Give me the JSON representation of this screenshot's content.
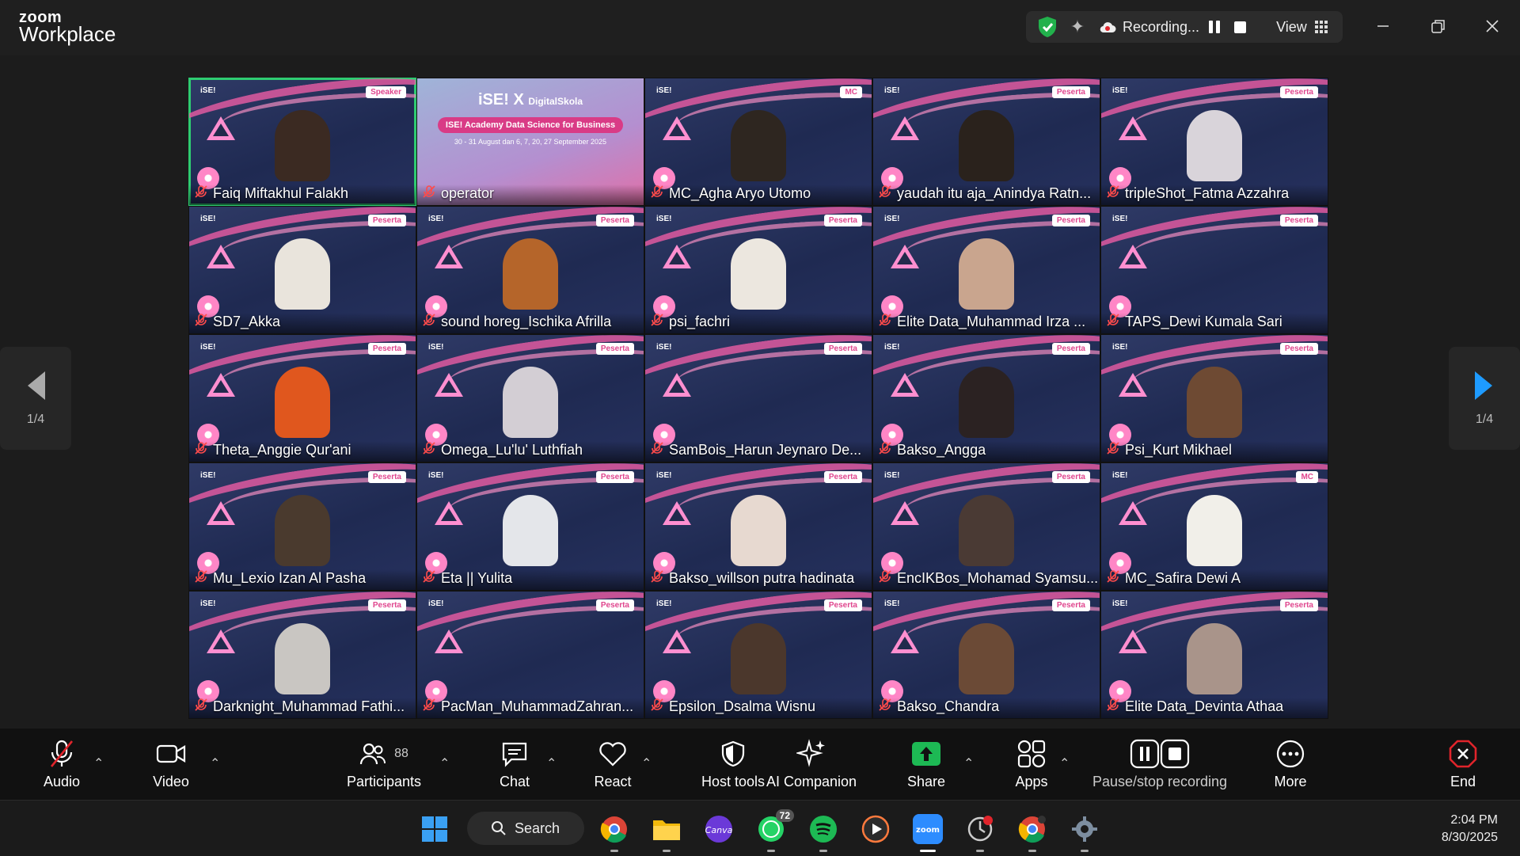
{
  "app": {
    "logo_top": "zoom",
    "logo_bottom": "Workplace"
  },
  "recording": {
    "status": "Recording...",
    "view_label": "View"
  },
  "navigation": {
    "page_left": "1/4",
    "page_right": "1/4"
  },
  "operator_tile": {
    "brand_left": "iSE!",
    "brand_x": "X",
    "brand_right": "DigitalSkola",
    "course": "ISE! Academy Data Science for Business",
    "dates": "30 - 31 August dan 6, 7, 20, 27 September 2025"
  },
  "participants": [
    {
      "name": "Faiq Miftakhul Falakh",
      "tag": "Speaker",
      "avatar_color": "#3b2a22"
    },
    {
      "name": "operator",
      "tag": "",
      "avatar_color": ""
    },
    {
      "name": "MC_Agha Aryo Utomo",
      "tag": "MC",
      "avatar_color": "#2e2620"
    },
    {
      "name": "yaudah itu aja_Anindya Ratn...",
      "tag": "Peserta",
      "avatar_color": "#2a221c"
    },
    {
      "name": "tripleShot_Fatma Azzahra",
      "tag": "Peserta",
      "avatar_color": "#d9d4da"
    },
    {
      "name": "SD7_Akka",
      "tag": "Peserta",
      "avatar_color": "#e9e4dc"
    },
    {
      "name": "sound horeg_Ischika Afrilla",
      "tag": "Peserta",
      "avatar_color": "#b5652a"
    },
    {
      "name": "psi_fachri",
      "tag": "Peserta",
      "avatar_color": "#ece7df"
    },
    {
      "name": "Elite Data_Muhammad Irza ...",
      "tag": "Peserta",
      "avatar_color": "#c9a58e"
    },
    {
      "name": "TAPS_Dewi Kumala Sari",
      "tag": "Peserta",
      "avatar_color": ""
    },
    {
      "name": "Theta_Anggie Qur'ani",
      "tag": "Peserta",
      "avatar_color": "#e0571e"
    },
    {
      "name": "Omega_Lu'lu' Luthfiah",
      "tag": "Peserta",
      "avatar_color": "#d3ced4"
    },
    {
      "name": "SamBois_Harun Jeynaro De...",
      "tag": "Peserta",
      "avatar_color": ""
    },
    {
      "name": "Bakso_Angga",
      "tag": "Peserta",
      "avatar_color": "#2b2222"
    },
    {
      "name": "Psi_Kurt Mikhael",
      "tag": "Peserta",
      "avatar_color": "#6e4a33"
    },
    {
      "name": "Mu_Lexio Izan Al Pasha",
      "tag": "Peserta",
      "avatar_color": "#4a3a2e"
    },
    {
      "name": "Eta || Yulita",
      "tag": "Peserta",
      "avatar_color": "#e4e6ea"
    },
    {
      "name": "Bakso_willson putra hadinata",
      "tag": "Peserta",
      "avatar_color": "#e7d9d0"
    },
    {
      "name": "EncIKBos_Mohamad Syamsu...",
      "tag": "Peserta",
      "avatar_color": "#4a3a34"
    },
    {
      "name": "MC_Safira Dewi A",
      "tag": "MC",
      "avatar_color": "#f1efe9"
    },
    {
      "name": "Darknight_Muhammad Fathi...",
      "tag": "Peserta",
      "avatar_color": "#c9c6c2"
    },
    {
      "name": "PacMan_MuhammadZahran...",
      "tag": "Peserta",
      "avatar_color": ""
    },
    {
      "name": "Epsilon_Dsalma Wisnu",
      "tag": "Peserta",
      "avatar_color": "#4b372c"
    },
    {
      "name": "Bakso_Chandra",
      "tag": "Peserta",
      "avatar_color": "#6b4a36"
    },
    {
      "name": "Elite Data_Devinta Athaa",
      "tag": "Peserta",
      "avatar_color": "#a9948a"
    }
  ],
  "toolbar": {
    "audio": "Audio",
    "video": "Video",
    "participants": "Participants",
    "participants_count": "88",
    "chat": "Chat",
    "react": "React",
    "host_tools": "Host tools",
    "ai_companion": "AI Companion",
    "share": "Share",
    "apps": "Apps",
    "pause_stop": "Pause/stop recording",
    "more": "More",
    "end": "End"
  },
  "taskbar": {
    "search": "Search",
    "whatsapp_badge": "72",
    "time": "2:04 PM",
    "date": "8/30/2025"
  },
  "colors": {
    "active_border": "#2ecc71",
    "share_green": "#1db954",
    "end_red": "#e0242b",
    "tile_bg": "#25305a",
    "accent_pink": "#e05aa0"
  }
}
